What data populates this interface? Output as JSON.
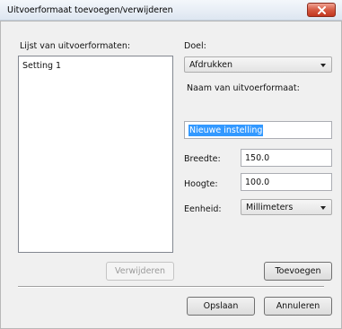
{
  "dialog": {
    "title": "Uitvoerformaat toevoegen/verwijderen",
    "close_icon": "close-x-icon"
  },
  "left": {
    "list_label": "Lijst van uitvoerformaten:",
    "items": [
      "Setting 1"
    ],
    "remove_button": "Verwijderen"
  },
  "right": {
    "doel_label": "Doel:",
    "doel_value": "Afdrukken",
    "naam_label": "Naam van uitvoerformaat:",
    "naam_value": "Nieuwe instelling",
    "breedte_label": "Breedte:",
    "breedte_value": "150.0",
    "hoogte_label": "Hoogte:",
    "hoogte_value": "100.0",
    "eenheid_label": "Eenheid:",
    "eenheid_value": "Millimeters",
    "add_button": "Toevoegen"
  },
  "footer": {
    "save_button": "Opslaan",
    "cancel_button": "Annuleren"
  },
  "colors": {
    "close_button": "#c2361f",
    "selection": "#3399ff"
  }
}
